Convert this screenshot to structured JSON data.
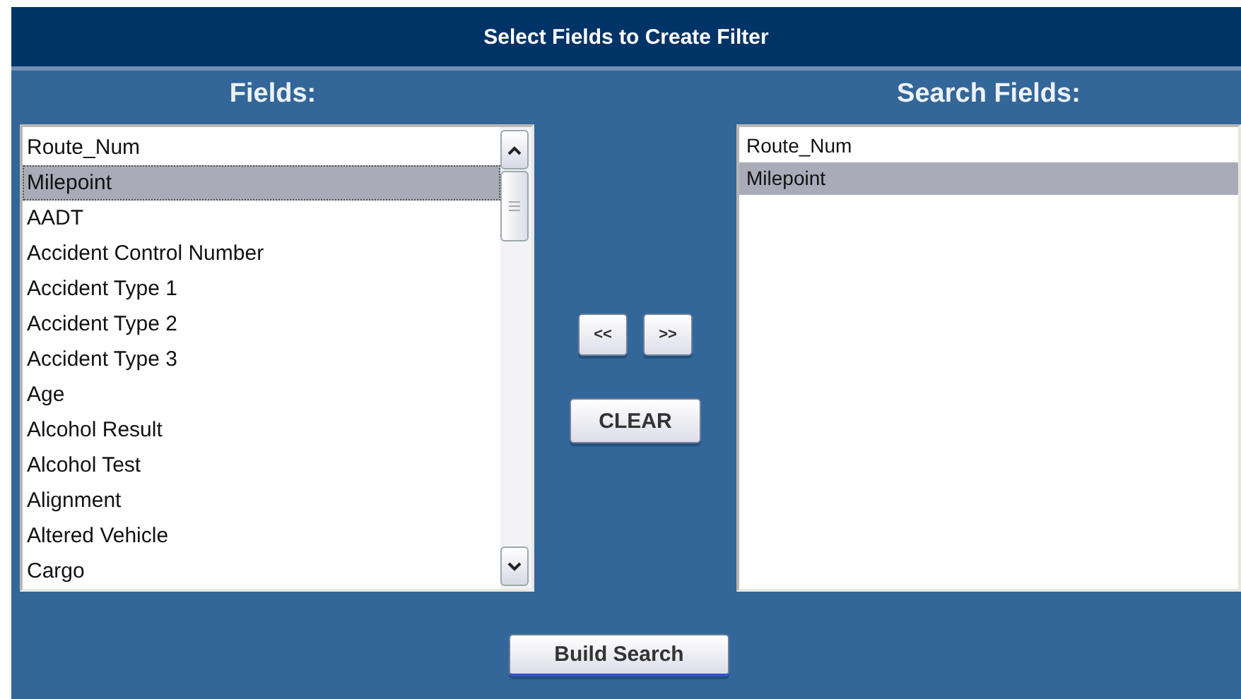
{
  "title": "Select Fields to Create Filter",
  "fields": {
    "heading": "Fields:",
    "items": [
      {
        "label": "Route_Num",
        "selected": false
      },
      {
        "label": "Milepoint",
        "selected": true
      },
      {
        "label": "AADT",
        "selected": false
      },
      {
        "label": "Accident Control Number",
        "selected": false
      },
      {
        "label": "Accident Type 1",
        "selected": false
      },
      {
        "label": "Accident Type 2",
        "selected": false
      },
      {
        "label": "Accident Type 3",
        "selected": false
      },
      {
        "label": "Age",
        "selected": false
      },
      {
        "label": "Alcohol Result",
        "selected": false
      },
      {
        "label": "Alcohol Test",
        "selected": false
      },
      {
        "label": "Alignment",
        "selected": false
      },
      {
        "label": "Altered Vehicle",
        "selected": false
      },
      {
        "label": "Cargo",
        "selected": false
      }
    ]
  },
  "move_buttons": [
    "<<",
    ">>"
  ],
  "clear_button": "CLEAR",
  "search_fields": {
    "heading": "Search Fields:",
    "items": [
      {
        "label": "Route_Num",
        "selected": false
      },
      {
        "label": "Milepoint",
        "selected": true
      }
    ]
  },
  "build_button": "Build Search"
}
